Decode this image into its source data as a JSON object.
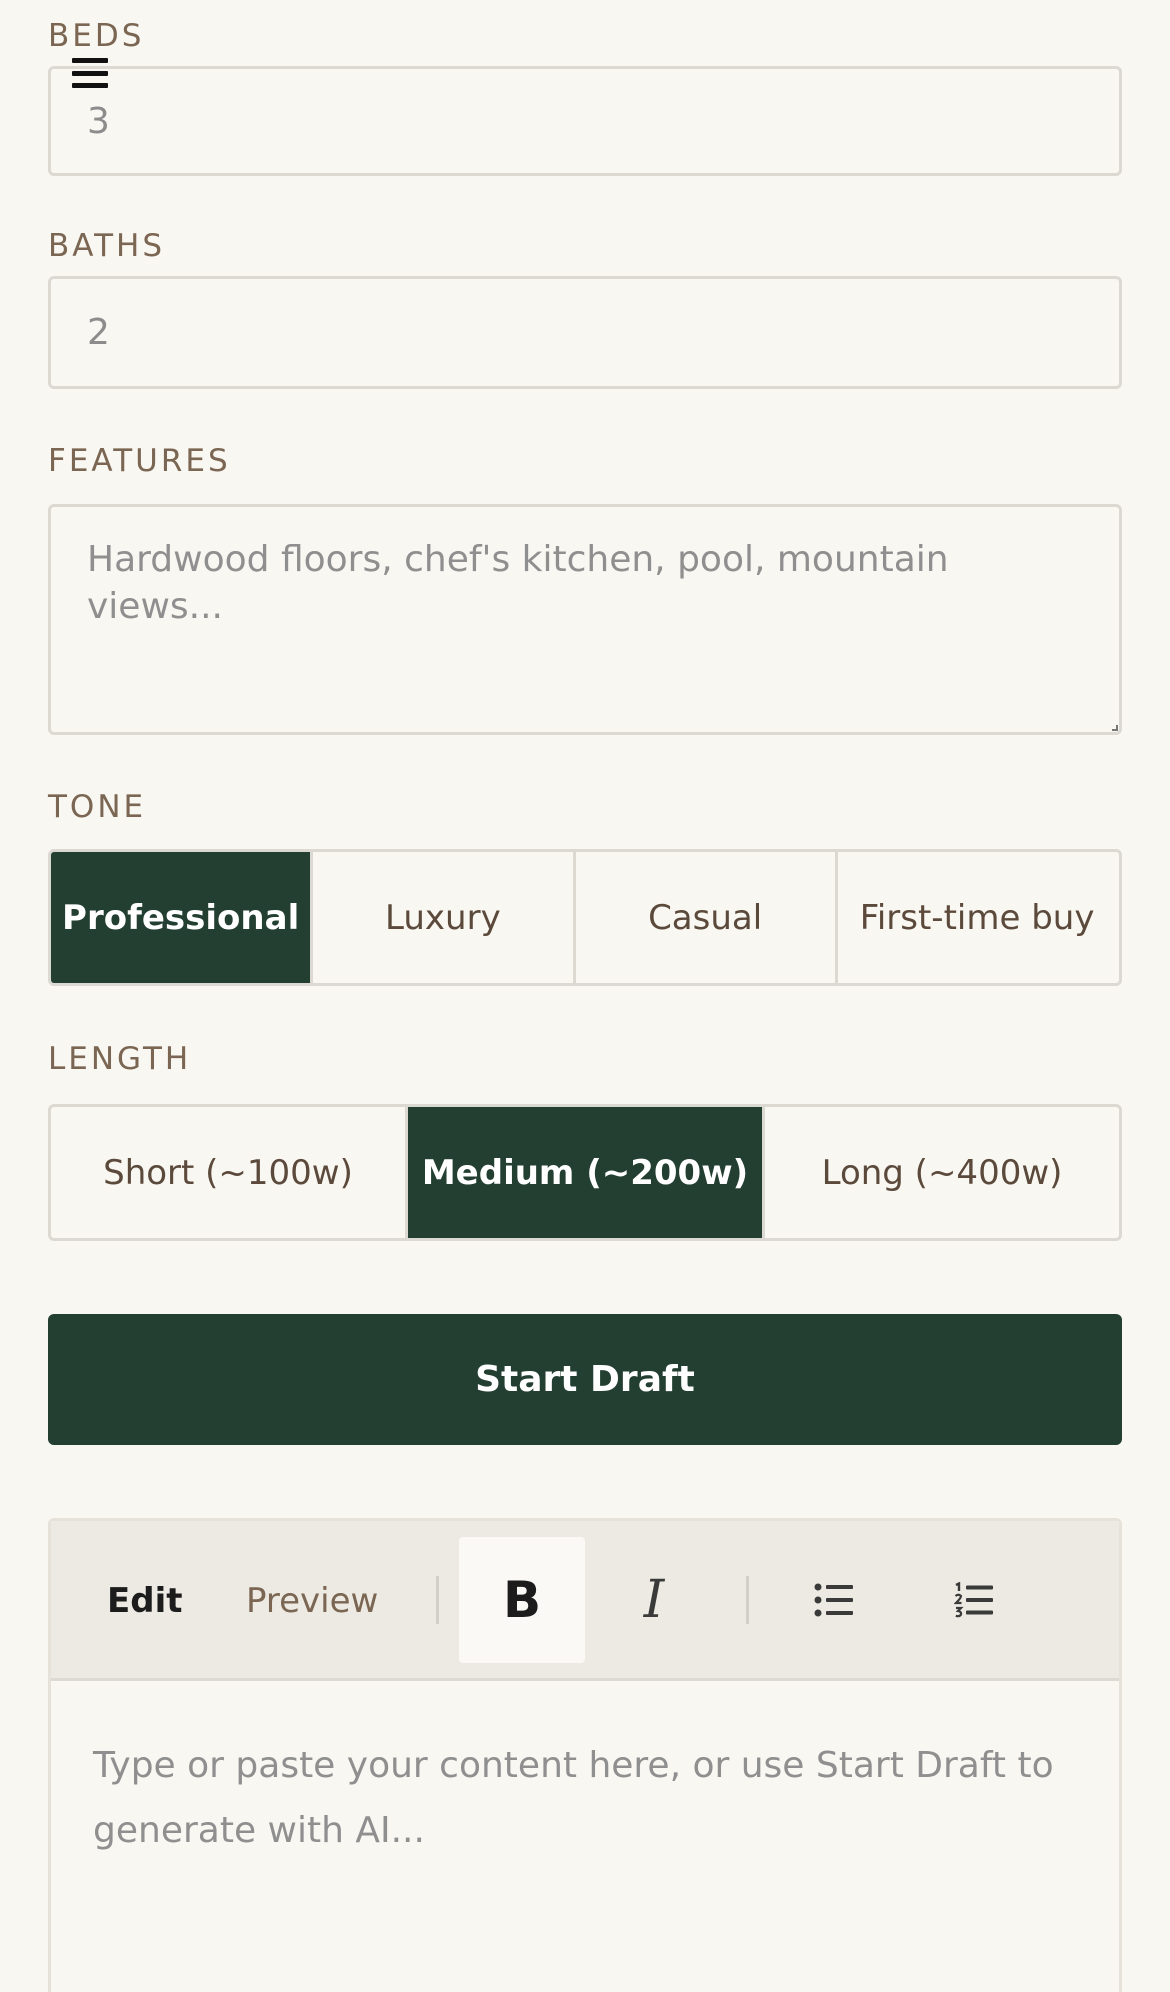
{
  "form": {
    "beds": {
      "label": "BEDS",
      "value": "3"
    },
    "baths": {
      "label": "BATHS",
      "value": "2"
    },
    "features": {
      "label": "FEATURES",
      "placeholder": "Hardwood floors, chef's kitchen, pool, mountain views..."
    },
    "tone": {
      "label": "TONE",
      "options": [
        "Professional",
        "Luxury",
        "Casual",
        "First-time buy"
      ],
      "selected": "Professional"
    },
    "length": {
      "label": "LENGTH",
      "options": [
        "Short (~100w)",
        "Medium (~200w)",
        "Long (~400w)"
      ],
      "selected": "Medium (~200w)"
    },
    "start_label": "Start Draft"
  },
  "editor": {
    "tabs": [
      "Edit",
      "Preview"
    ],
    "active_tab": "Edit",
    "bold_glyph": "B",
    "italic_glyph": "I",
    "placeholder": "Type or paste your content here, or use Start Draft to generate with AI..."
  },
  "icons": {
    "menu": "hamburger-menu-icon",
    "bullet_list": "bullet-list-icon",
    "numbered_list": "numbered-list-icon"
  },
  "colors": {
    "accent": "#233f32",
    "label": "#7a6652",
    "background": "#f9f7f2",
    "border": "#dcd9d3"
  }
}
